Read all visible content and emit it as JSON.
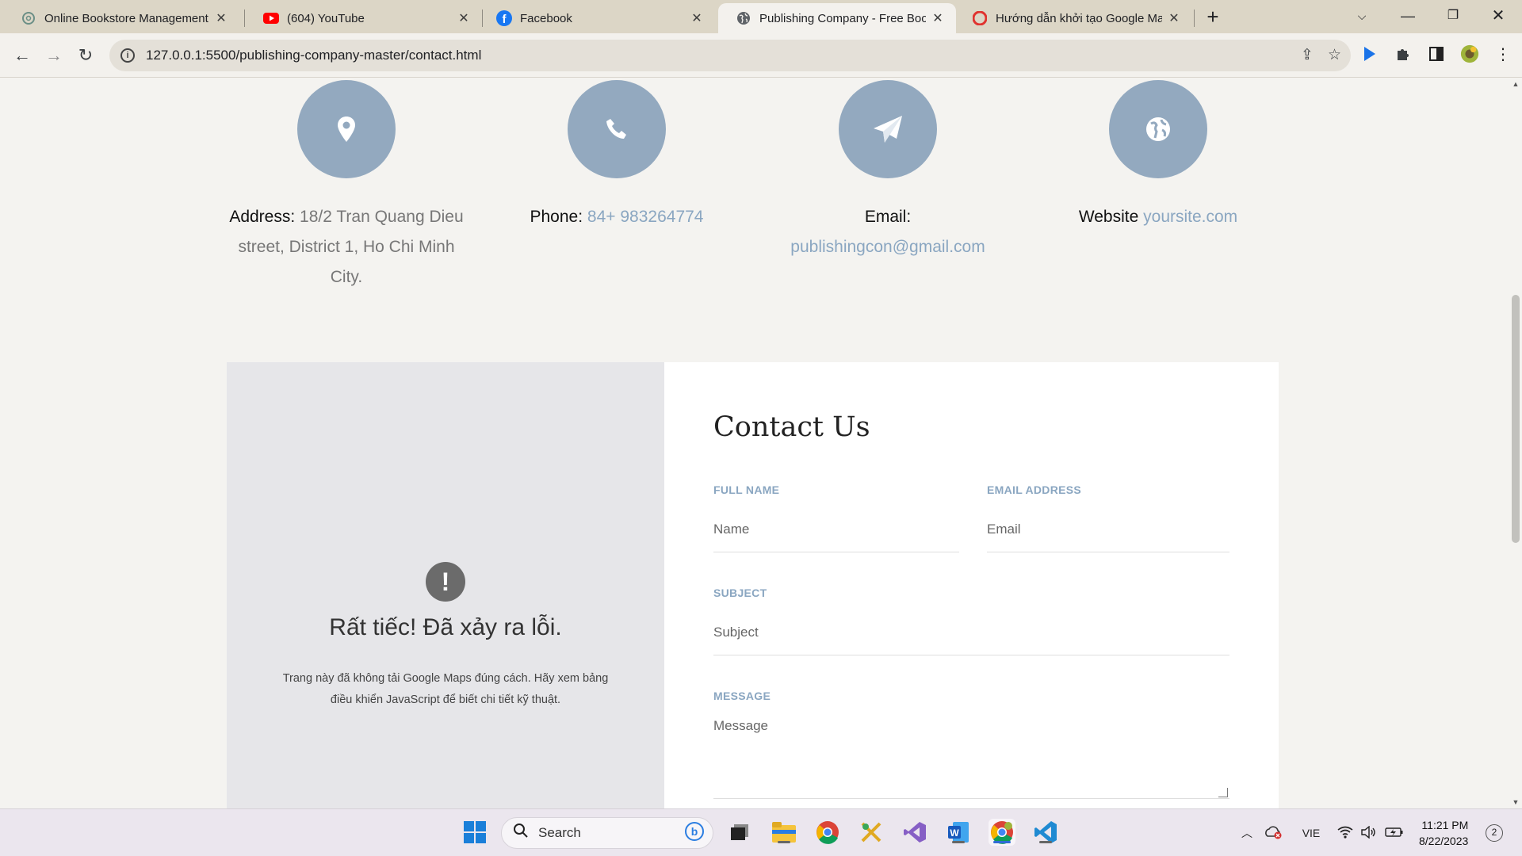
{
  "browser": {
    "tabs": [
      {
        "title": "Online Bookstore Management S",
        "icon": "chatgpt-icon"
      },
      {
        "title": "(604) YouTube",
        "icon": "youtube-icon"
      },
      {
        "title": "Facebook",
        "icon": "facebook-icon"
      },
      {
        "title": "Publishing Company - Free Boots",
        "icon": "globe-icon",
        "active": true
      },
      {
        "title": "Hướng dẫn khởi tạo Google Map",
        "icon": "opera-icon"
      }
    ],
    "url": "127.0.0.1:5500/publishing-company-master/contact.html"
  },
  "contact_info": {
    "address": {
      "label": "Address:",
      "value": "18/2 Tran Quang Dieu street, District 1, Ho Chi Minh City."
    },
    "phone": {
      "label": "Phone:",
      "value": "84+ 983264774"
    },
    "email": {
      "label": "Email:",
      "value": "publishingcon@gmail.com"
    },
    "website": {
      "label": "Website",
      "value": "yoursite.com"
    }
  },
  "map_error": {
    "title": "Rất tiếc! Đã xảy ra lỗi.",
    "description": "Trang này đã không tải Google Maps đúng cách. Hãy xem bảng điều khiển JavaScript để biết chi tiết kỹ thuật."
  },
  "form": {
    "title": "Contact Us",
    "full_name_label": "FULL NAME",
    "full_name_placeholder": "Name",
    "email_label": "EMAIL ADDRESS",
    "email_placeholder": "Email",
    "subject_label": "SUBJECT",
    "subject_placeholder": "Subject",
    "message_label": "MESSAGE",
    "message_placeholder": "Message"
  },
  "taskbar": {
    "search_label": "Search",
    "language": "VIE",
    "time": "11:21 PM",
    "date": "8/22/2023",
    "notifications": "2"
  },
  "colors": {
    "accent": "#93a9bf",
    "link": "#8aa6c1",
    "page_bg": "#f4f3f0"
  }
}
